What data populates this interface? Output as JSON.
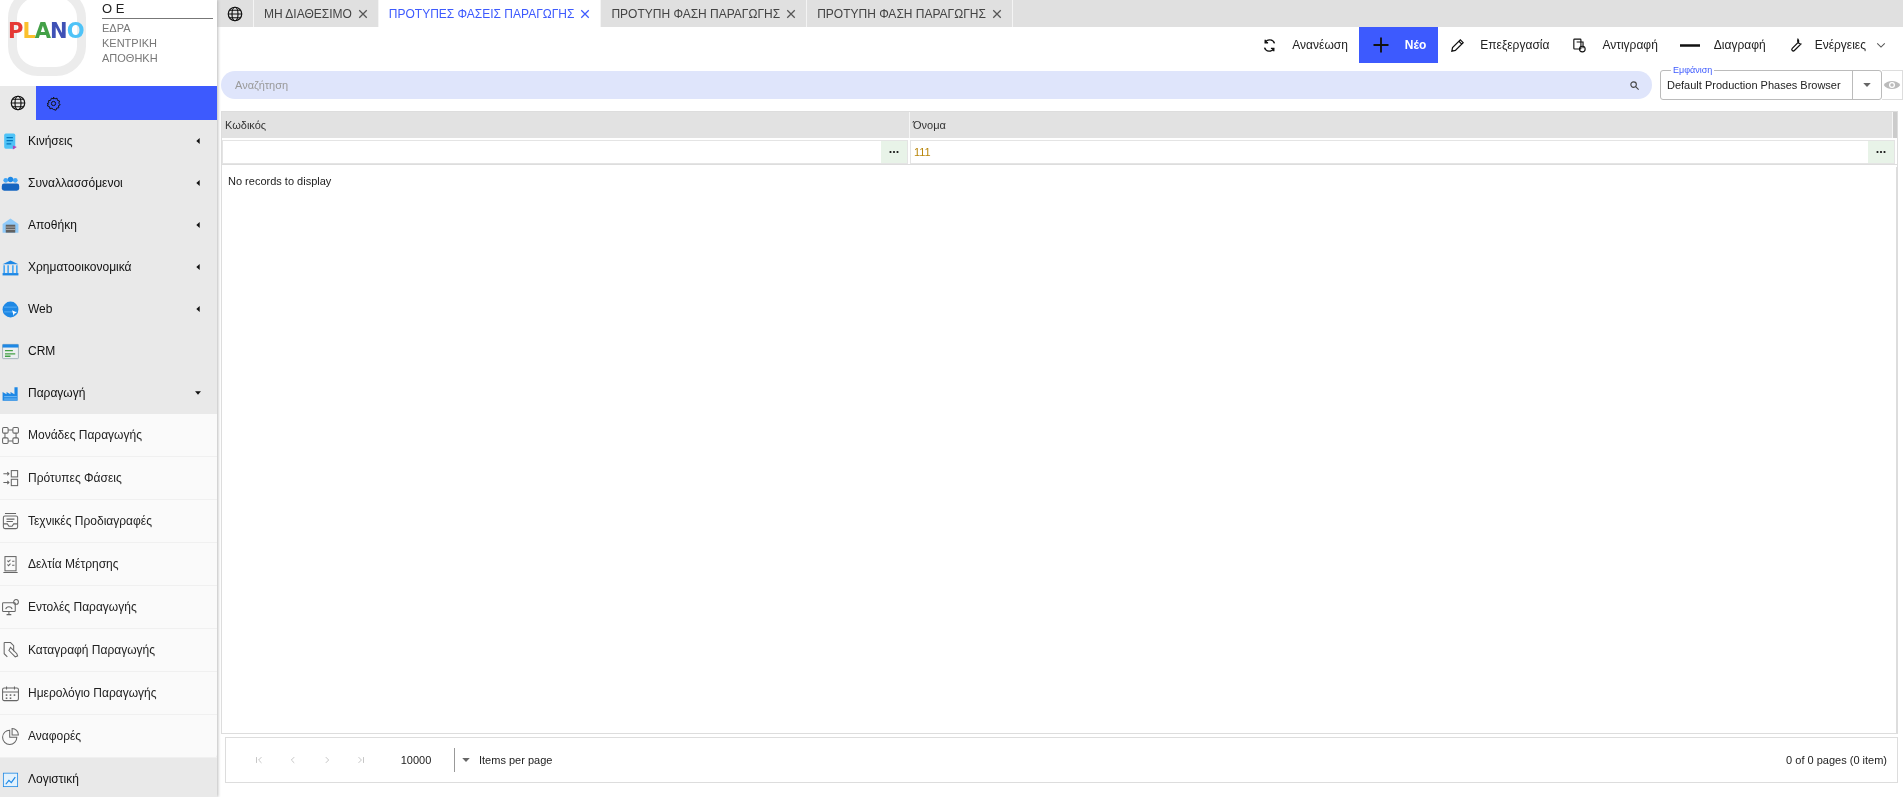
{
  "brand": {
    "logo": "PLANO",
    "company": "Ο Ε",
    "lines": [
      "ΕΔΡΑ",
      "ΚΕΝΤΡΙΚΗ",
      "ΑΠΟΘΗΚΗ"
    ]
  },
  "sidebar": {
    "items": [
      {
        "label": "Κινήσεις",
        "kind": "group",
        "expanded": false
      },
      {
        "label": "Συναλλασσόμενοι",
        "kind": "group",
        "expanded": false
      },
      {
        "label": "Αποθήκη",
        "kind": "group",
        "expanded": false
      },
      {
        "label": "Χρηματοοικονομικά",
        "kind": "group",
        "expanded": false
      },
      {
        "label": "Web",
        "kind": "group",
        "expanded": false
      },
      {
        "label": "CRM",
        "kind": "link"
      },
      {
        "label": "Παραγωγή",
        "kind": "group",
        "expanded": true,
        "children": [
          {
            "label": "Μονάδες Παραγωγής"
          },
          {
            "label": "Πρότυπες Φάσεις"
          },
          {
            "label": "Τεχνικές Προδιαγραφές"
          },
          {
            "label": "Δελτία Μέτρησης"
          },
          {
            "label": "Εντολές Παραγωγής"
          },
          {
            "label": "Καταγραφή Παραγωγής"
          },
          {
            "label": "Ημερολόγιο Παραγωγής"
          },
          {
            "label": "Αναφορές"
          }
        ]
      },
      {
        "label": "Λογιστική",
        "kind": "link"
      }
    ]
  },
  "tabs": [
    {
      "label": "ΜΗ ΔΙΑΘΕΣΙΜΟ",
      "selected": false
    },
    {
      "label": "ΠΡΟΤΥΠΕΣ ΦΑΣΕΙΣ ΠΑΡΑΓΩΓΗΣ",
      "selected": true
    },
    {
      "label": "ΠΡΟΤΥΠΗ ΦΑΣΗ ΠΑΡΑΓΩΓΗΣ",
      "selected": false
    },
    {
      "label": "ΠΡΟΤΥΠΗ ΦΑΣΗ ΠΑΡΑΓΩΓΗΣ",
      "selected": false
    }
  ],
  "toolbar": [
    {
      "label": "Ανανέωση",
      "kind": "refresh"
    },
    {
      "label": "Νέο",
      "kind": "new"
    },
    {
      "label": "Επεξεργασία",
      "kind": "edit"
    },
    {
      "label": "Αντιγραφή",
      "kind": "copy"
    },
    {
      "label": "Διαγραφή",
      "kind": "delete"
    },
    {
      "label": "Ενέργειες",
      "kind": "menu"
    }
  ],
  "search": {
    "placeholder": "Αναζήτηση"
  },
  "view": {
    "label": "Εμφάνιση",
    "value": "Default Production Phases Browser"
  },
  "table": {
    "columns": [
      {
        "title": "Κωδικός"
      },
      {
        "title": "Όνομα",
        "filter": "111"
      }
    ],
    "empty": "No records to display"
  },
  "pager": {
    "page_size": "10000",
    "page_size_label": "Items per page",
    "info": "0 of 0 pages (0 item)"
  }
}
